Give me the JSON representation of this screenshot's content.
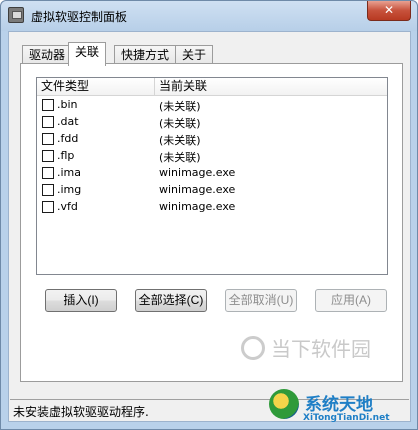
{
  "window": {
    "title": "虚拟软驱控制面板",
    "close_label": "✕"
  },
  "tabs": [
    "驱动器",
    "关联",
    "快捷方式",
    "关于"
  ],
  "list": {
    "columns": [
      "文件类型",
      "当前关联"
    ],
    "rows": [
      {
        "type": ".bin",
        "assoc": "(未关联)"
      },
      {
        "type": ".dat",
        "assoc": "(未关联)"
      },
      {
        "type": ".fdd",
        "assoc": "(未关联)"
      },
      {
        "type": ".flp",
        "assoc": "(未关联)"
      },
      {
        "type": ".ima",
        "assoc": "winimage.exe"
      },
      {
        "type": ".img",
        "assoc": "winimage.exe"
      },
      {
        "type": ".vfd",
        "assoc": "winimage.exe"
      }
    ]
  },
  "buttons": {
    "insert": "插入(I)",
    "select_all": "全部选择(C)",
    "deselect_all": "全部取消(U)",
    "apply": "应用(A)"
  },
  "status": {
    "text": "未安装虚拟软驱驱动程序."
  },
  "watermarks": {
    "one": "当下软件园",
    "two": "系统天地",
    "two_sub": "XiTongTianDi.net"
  }
}
